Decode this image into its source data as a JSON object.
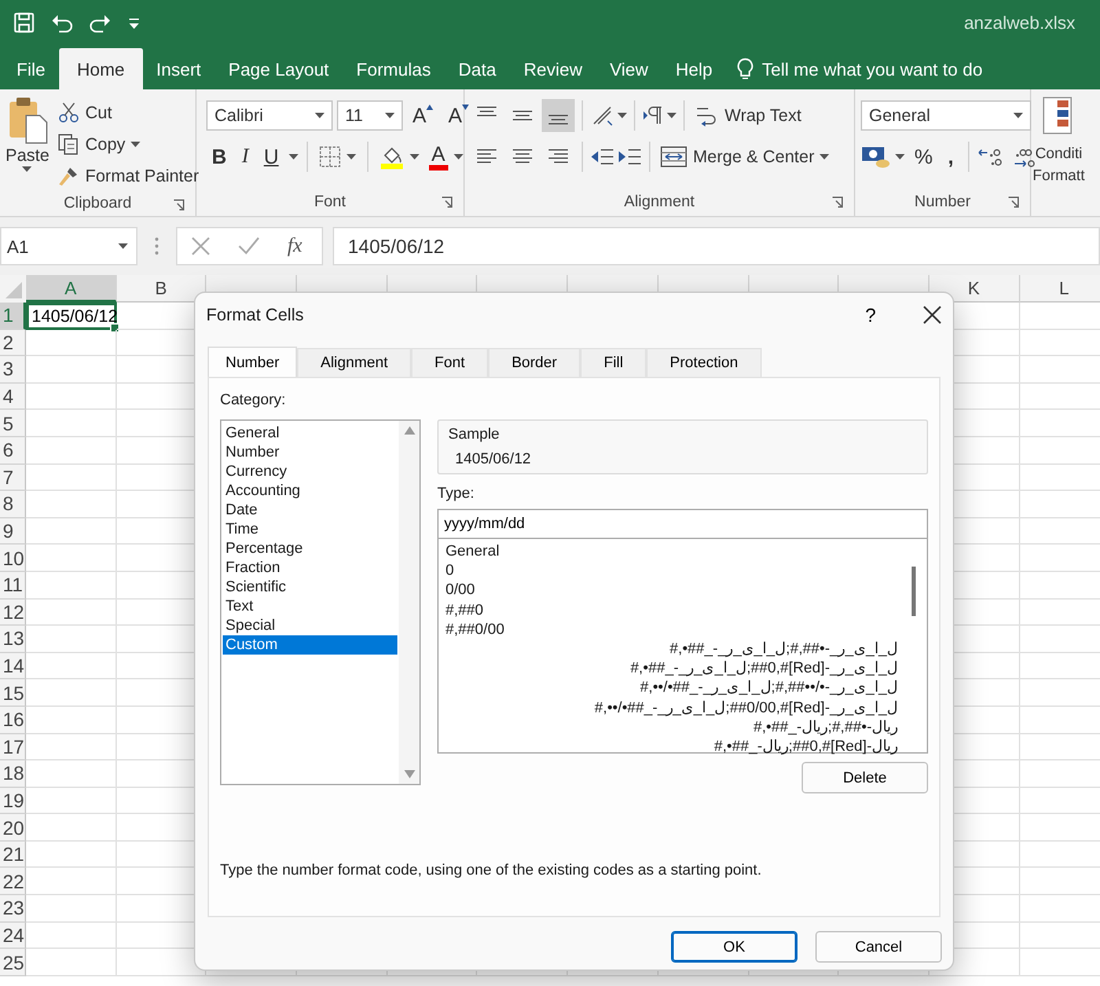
{
  "title_bar": {
    "file_name": "anzalweb.xlsx"
  },
  "ribbon_tabs": [
    {
      "label": "File",
      "selected": false
    },
    {
      "label": "Home",
      "selected": true
    },
    {
      "label": "Insert",
      "selected": false
    },
    {
      "label": "Page Layout",
      "selected": false
    },
    {
      "label": "Formulas",
      "selected": false
    },
    {
      "label": "Data",
      "selected": false
    },
    {
      "label": "Review",
      "selected": false
    },
    {
      "label": "View",
      "selected": false
    },
    {
      "label": "Help",
      "selected": false
    }
  ],
  "tell_me": {
    "placeholder": "Tell me what you want to do"
  },
  "ribbon": {
    "clipboard": {
      "paste": "Paste",
      "cut": "Cut",
      "copy": "Copy",
      "format_painter": "Format Painter",
      "label": "Clipboard"
    },
    "font": {
      "font_name": "Calibri",
      "font_size": "11",
      "grow": "A",
      "shrink": "A",
      "bold": "B",
      "italic": "I",
      "underline": "U",
      "font_color": "A",
      "label": "Font"
    },
    "alignment": {
      "vertical": [
        {
          "selected": false
        },
        {
          "selected": false
        },
        {
          "selected": true
        }
      ],
      "horizontal": [
        {
          "selected": false
        },
        {
          "selected": false
        },
        {
          "selected": false
        }
      ],
      "wrap_text": "Wrap Text",
      "merge_center": "Merge & Center",
      "label": "Alignment"
    },
    "number": {
      "format": "General",
      "percent": "%",
      "comma": ",",
      "label": "Number"
    },
    "styles": {
      "conditional_formatting": [
        "Conditi",
        "Formatt"
      ]
    }
  },
  "formula_bar": {
    "name_box": "A1",
    "fx": "fx",
    "value": "1405/06/12"
  },
  "sheet": {
    "columns": [
      {
        "label": "A",
        "selected": true
      },
      {
        "label": "B",
        "selected": false
      },
      {
        "selected": false
      },
      {
        "selected": false
      },
      {
        "selected": false
      },
      {
        "selected": false
      },
      {
        "selected": false
      },
      {
        "selected": false
      },
      {
        "selected": false
      },
      {
        "selected": false
      },
      {
        "label": "K",
        "selected": false
      },
      {
        "label": "L",
        "selected": false
      }
    ],
    "rows": [
      {
        "label": "1",
        "selected": true,
        "cells": [
          {
            "value": "1405/06/12",
            "selected": true
          }
        ]
      },
      {
        "label": "2",
        "selected": false
      },
      {
        "label": "3",
        "selected": false
      },
      {
        "label": "4",
        "selected": false
      },
      {
        "label": "5",
        "selected": false
      },
      {
        "label": "6",
        "selected": false
      },
      {
        "label": "7",
        "selected": false
      },
      {
        "label": "8",
        "selected": false
      },
      {
        "label": "9",
        "selected": false
      },
      {
        "label": "10",
        "selected": false
      },
      {
        "label": "11",
        "selected": false
      },
      {
        "label": "12",
        "selected": false
      },
      {
        "label": "13",
        "selected": false
      },
      {
        "label": "14",
        "selected": false
      },
      {
        "label": "15",
        "selected": false
      },
      {
        "label": "16",
        "selected": false
      },
      {
        "label": "17",
        "selected": false
      },
      {
        "label": "18",
        "selected": false
      },
      {
        "label": "19",
        "selected": false
      },
      {
        "label": "20",
        "selected": false
      },
      {
        "label": "21",
        "selected": false
      },
      {
        "label": "22",
        "selected": false
      },
      {
        "label": "23",
        "selected": false
      },
      {
        "label": "24",
        "selected": false
      },
      {
        "label": "25",
        "selected": false
      }
    ]
  },
  "dialog": {
    "title": "Format Cells",
    "help": "?",
    "tabs": [
      {
        "label": "Number",
        "selected": true
      },
      {
        "label": "Alignment",
        "selected": false
      },
      {
        "label": "Font",
        "selected": false
      },
      {
        "label": "Border",
        "selected": false
      },
      {
        "label": "Fill",
        "selected": false
      },
      {
        "label": "Protection",
        "selected": false
      }
    ],
    "category_label": "Category:",
    "categories": [
      {
        "label": "General",
        "selected": false
      },
      {
        "label": "Number",
        "selected": false
      },
      {
        "label": "Currency",
        "selected": false
      },
      {
        "label": "Accounting",
        "selected": false
      },
      {
        "label": "Date",
        "selected": false
      },
      {
        "label": "Time",
        "selected": false
      },
      {
        "label": "Percentage",
        "selected": false
      },
      {
        "label": "Fraction",
        "selected": false
      },
      {
        "label": "Scientific",
        "selected": false
      },
      {
        "label": "Text",
        "selected": false
      },
      {
        "label": "Special",
        "selected": false
      },
      {
        "label": "Custom",
        "selected": true
      }
    ],
    "sample_label": "Sample",
    "sample_value": "1405/06/12",
    "type_label": "Type:",
    "type_value": "yyyy/mm/dd",
    "formats": [
      "General",
      "0",
      "0/00",
      "#,##0",
      "#,##0/00",
      "ل_ا_ی_ر_-•##,#;ل_ا_ی_ر_-_##•,#",
      "ل_ا_ی_ر_-[Red]#,##0;ل_ا_ی_ر_-_##•,#",
      "ل_ا_ی_ر_-•/••##,#;ل_ا_ی_ر_-_##•/••,#",
      "ل_ا_ی_ر_-[Red]#,##0/00;ل_ا_ی_ر_-_##•/••,#",
      "ریال-•##,#;ریال-_##•,#",
      "ریال-[Red]#,##0;ریال-_##•,#"
    ],
    "delete": "Delete",
    "hint": "Type the number format code, using one of the existing codes as a starting point.",
    "ok": "OK",
    "cancel": "Cancel"
  }
}
